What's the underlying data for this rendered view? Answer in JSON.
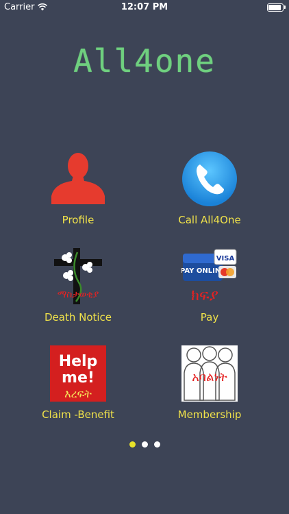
{
  "status_bar": {
    "carrier": "Carrier",
    "time": "12:07 PM",
    "battery_level": 1.0
  },
  "app_title": "All4one",
  "tiles": [
    {
      "label": "Profile",
      "icon": "person-silhouette-icon"
    },
    {
      "label": "Call All4One",
      "icon": "phone-icon"
    },
    {
      "label": "Death Notice",
      "icon": "cross-with-flowers-icon",
      "overlay_text": "ማስታወቂያ"
    },
    {
      "label": "Pay",
      "icon": "pay-online-cards-icon",
      "badge_text": "PAY ONLINE",
      "card_text": "VISA",
      "overlay_text": "ክፍያ"
    },
    {
      "label": "Claim -Benefit",
      "icon": "help-me-icon",
      "line1": "Help",
      "line2": "me!",
      "overlay_text": "እረፍት"
    },
    {
      "label": "Membership",
      "icon": "group-people-icon",
      "overlay_text": "አባልነት"
    }
  ],
  "page_indicator": {
    "count": 3,
    "current": 1
  },
  "colors": {
    "background": "#3d4456",
    "title": "#6fd07f",
    "label": "#f0e24a",
    "active_dot": "#e8e22a"
  }
}
